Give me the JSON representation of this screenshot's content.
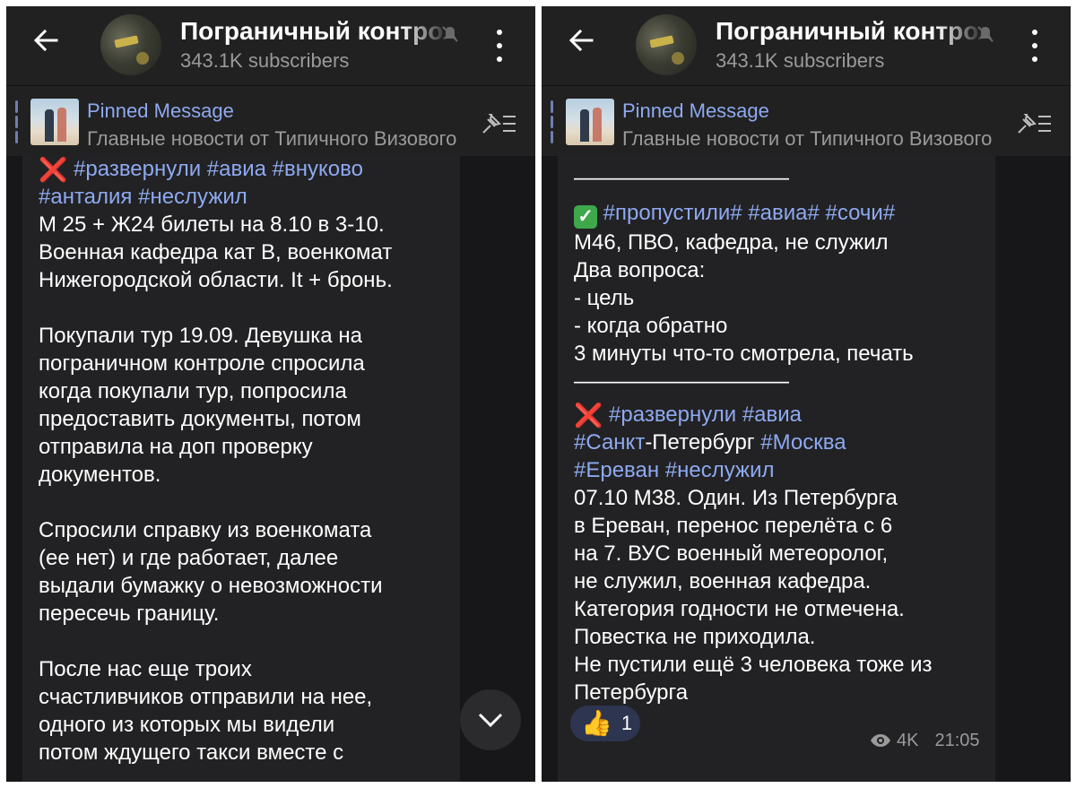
{
  "channel": {
    "name": "Пограничный контроль",
    "subscribers": "343.1K subscribers"
  },
  "pinned": {
    "title": "Pinned Message",
    "preview": "Главные новости от Типичного Визового"
  },
  "left_message": {
    "tags_line1": "#развернули #авиа #внуково",
    "tags_line2": "#анталия #неслужил",
    "lines_a": [
      "М 25 + Ж24 билеты на 8.10 в 3-10.",
      "Военная кафедра кат В, военкомат",
      "Нижегородской области. It + бронь."
    ],
    "lines_b": [
      "Покупали тур 19.09. Девушка на",
      "пограничном контроле спросила",
      "когда покупали тур, попросила",
      "предоставить документы, потом",
      "отправила на доп проверку",
      "документов."
    ],
    "lines_c": [
      "Спросили справку из военкомата",
      "(ее нет) и где работает, далее",
      "выдали бумажку о невозможности",
      "пересечь границу."
    ],
    "lines_d": [
      "После нас еще троих",
      "счастливчиков отправили на нее,",
      "одного из которых мы видели",
      "потом ждущего такси вместе с"
    ]
  },
  "right_message": {
    "separator": "——————————",
    "post1": {
      "tags": "#пропустили# #авиа# #сочи#",
      "lines": [
        "М46, ПВО, кафедра, не служил",
        "Два вопроса:",
        "- цель",
        "- когда обратно",
        "3 минуты что-то смотрела, печать"
      ]
    },
    "post2": {
      "tag_a": "#развернули",
      "tag_b": "#авиа",
      "tag_c": "#Санкт",
      "text_c": "-Петербург ",
      "tag_d": "#Москва",
      "tag_e": "#Ереван",
      "tag_f": "#неслужил",
      "lines": [
        "07.10 М38. Один. Из Петербурга",
        "в Ереван, перенос перелёта с 6",
        "на 7. ВУС военный метеоролог,",
        "не служил, военная кафедра.",
        "Категория годности не отмечена.",
        "Повестка не приходила.",
        "Не пустили ещё 3 человека тоже из",
        "Петербурга"
      ]
    },
    "reaction": {
      "emoji": "👍",
      "count": "1"
    },
    "views": "4K",
    "time": "21:05"
  },
  "icons": [
    "back-arrow-icon",
    "mute-icon",
    "more-vert-icon",
    "unpin-icon",
    "scroll-down-icon",
    "eye-icon",
    "cross-mark-icon",
    "check-mark-icon",
    "thumbs-up-icon"
  ],
  "colors": {
    "background": "#17171a",
    "header": "#212121",
    "bubble": "#222224",
    "link": "#8ea9f0",
    "reaction": "#2d3550"
  }
}
